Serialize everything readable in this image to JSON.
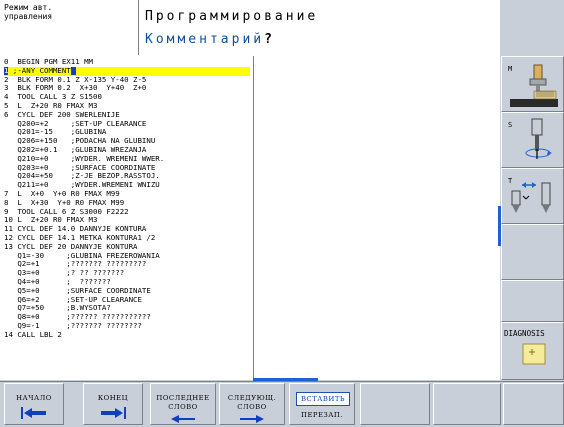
{
  "header": {
    "mode_line1": "Режим авт.",
    "mode_line2": "управления",
    "title": "Программирование",
    "subtitle": "Комментарий",
    "subtitle_mark": "?"
  },
  "program": {
    "selected_line_number": "1",
    "selected_line_text": ";-ANY COMMENT",
    "lines": [
      "0  BEGIN PGM EX11 MM",
      "2  BLK FORM 0.1 Z X-135 Y-40 Z-5",
      "3  BLK FORM 0.2  X+30  Y+40  Z+0",
      "4  TOOL CALL 3 Z S1500",
      "5  L  Z+20 R0 FMAX M3",
      "6  CYCL DEF 200 SWERLENIJE",
      "   Q200=+2     ;SET-UP CLEARANCE",
      "   Q201=-15    ;GLUBINA",
      "   Q206=+150   ;PODACHA NA GLUBINU",
      "   Q202=+0.1   ;GLUBINA WREZANJA",
      "   Q210=+0     ;WYDER. WREMENI WWER.",
      "   Q203=+0     ;SURFACE COORDINATE",
      "   Q204=+50    ;Z-JE BEZOP.RASSTOJ.",
      "   Q211=+0     ;WYDER.WREMENI WNIZU",
      "7  L  X+0  Y+0 R0 FMAX M99",
      "8  L  X+30  Y+0 R0 FMAX M99",
      "9  TOOL CALL 6 Z S3000 F2222",
      "10 L  Z+20 R0 FMAX M3",
      "11 CYCL DEF 14.0 DANNYJE KONTURA",
      "12 CYCL DEF 14.1 METKA KONTURA1 /2",
      "13 CYCL DEF 20 DANNYJE KONTURA",
      "   Q1=-30     ;GLUBINA FREZEROWANIA",
      "   Q2=+1      ;??????? ?????????",
      "   Q3=+0      ;? ?? ???????",
      "   Q4=+0      ;  ???????",
      "   Q5=+0      ;SURFACE COORDINATE",
      "   Q6=+2      ;SET-UP CLEARANCE",
      "   Q7=+50     ;B.WYSOTA?",
      "   Q8=+0      ;?????? ???????????",
      "   Q9=-1      ;??????? ????????",
      "14 CALL LBL 2"
    ]
  },
  "right_softkeys": {
    "m_label": "M",
    "s_label": "S",
    "t_label": "T",
    "diagnosis_label": "DIAGNOSIS"
  },
  "bottom_softkeys": {
    "start": "НАЧАЛО",
    "end": "КОНЕЦ",
    "last_word_1": "ПОСЛЕДНЕЕ",
    "last_word_2": "СЛОВО",
    "next_word_1": "СЛЕДУЮЩ.",
    "next_word_2": "СЛОВО",
    "insert_1": "ВСТАВИТЬ",
    "insert_2": "ПЕРЕЗАП."
  },
  "colors": {
    "accent": "#1040c0",
    "highlight": "#ffff00",
    "panel": "#c9cfd8"
  }
}
